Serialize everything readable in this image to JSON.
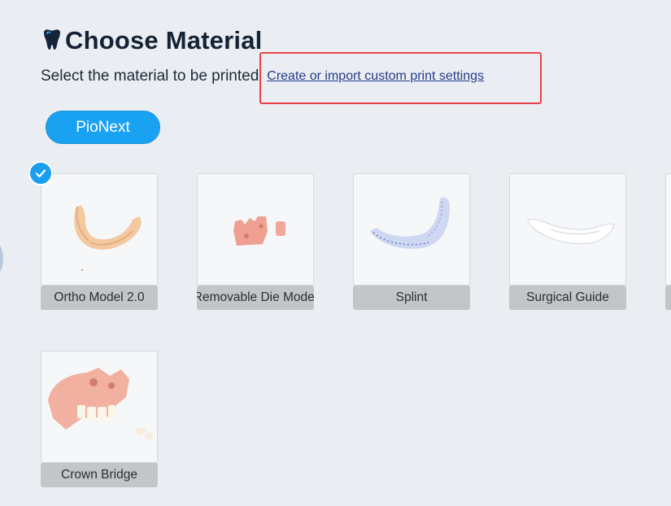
{
  "header": {
    "title": "Choose Material",
    "subtitle": "Select the material to be printed",
    "custom_link": "Create or import custom print settings",
    "logo_icon": "tooth-icon"
  },
  "brand_filter": {
    "label": "PioNext",
    "selected": true
  },
  "colors": {
    "accent": "#1aa2f2",
    "highlight_border": "#e8424a",
    "link": "#263a8c",
    "label_bg": "#c3c5c8"
  },
  "materials": [
    {
      "label": "Ortho Model 2.0",
      "selected": true
    },
    {
      "label": "Removable Die Model",
      "selected": false
    },
    {
      "label": "Splint",
      "selected": false
    },
    {
      "label": "Surgical Guide",
      "selected": false
    },
    {
      "label": "Crown Bridge",
      "selected": false
    }
  ]
}
